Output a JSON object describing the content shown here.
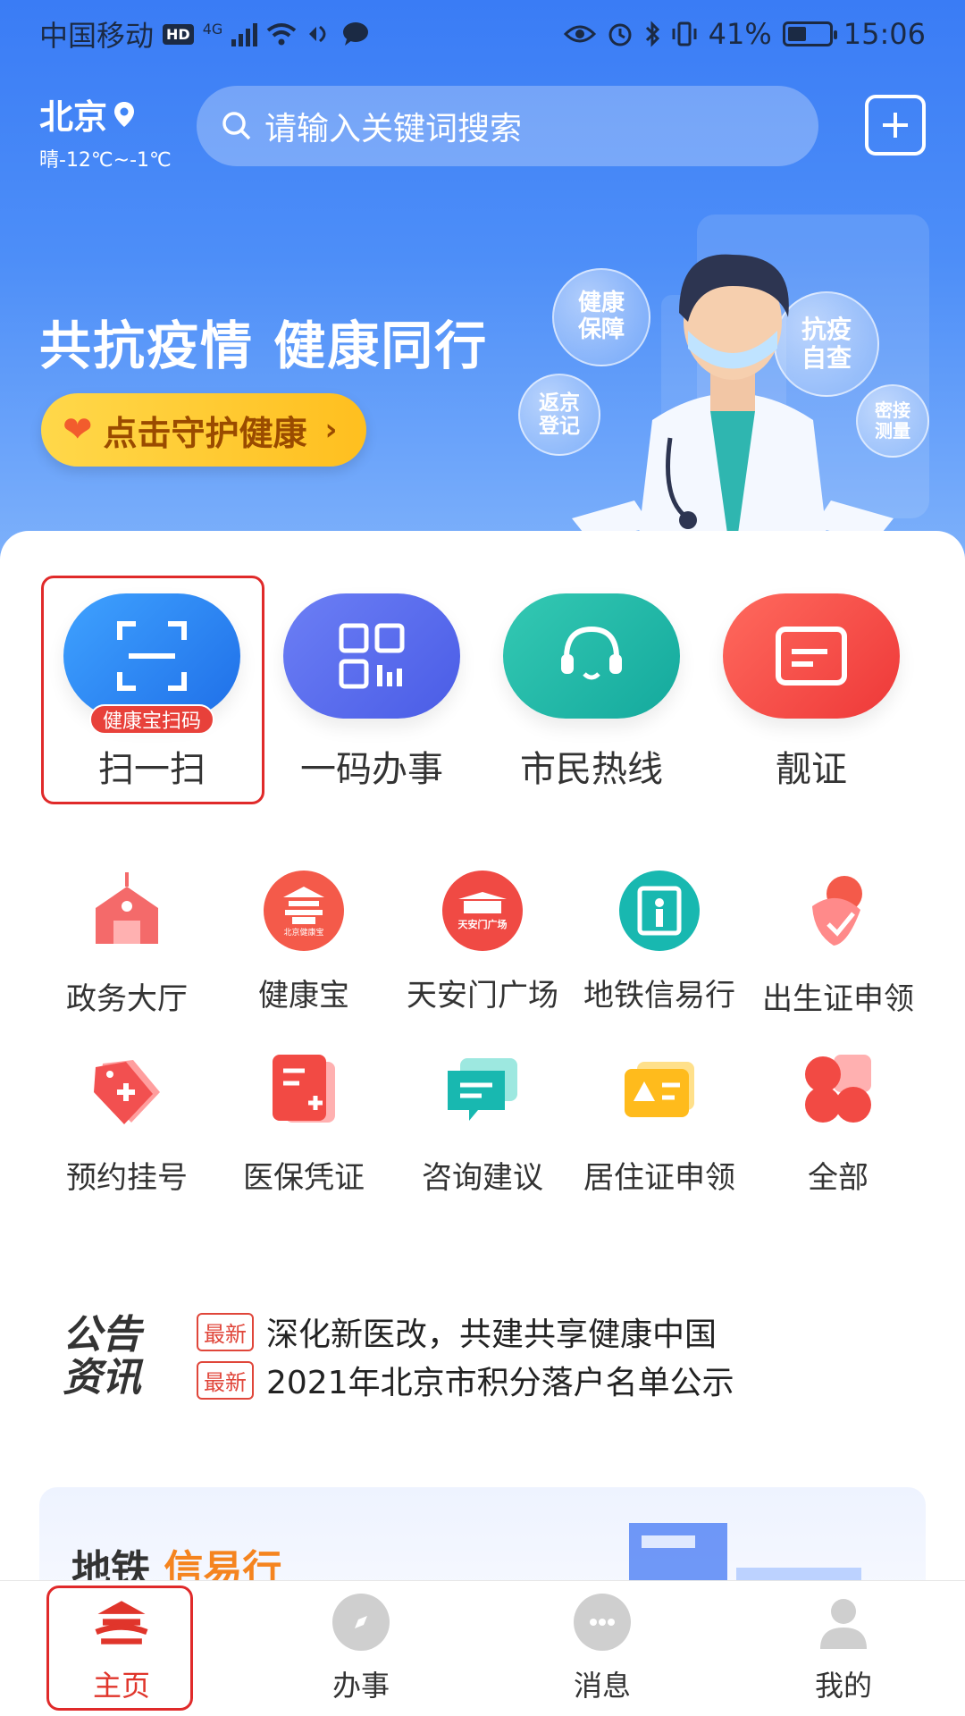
{
  "status_bar": {
    "carrier": "中国移动",
    "hd": "HD",
    "network": "4G",
    "battery": "41%",
    "time": "15:06"
  },
  "header": {
    "city": "北京",
    "weather": "晴-12℃~-1℃",
    "search_placeholder": "请输入关键词搜索"
  },
  "banner": {
    "slogan": "共抗疫情  健康同行",
    "cta_label": "点击守护健康",
    "bubbles": [
      "健康保障",
      "抗疫自查",
      "返京登记",
      "密接测量"
    ]
  },
  "main_functions": [
    {
      "label": "扫一扫",
      "badge": "健康宝扫码",
      "color": "#2f8cf5"
    },
    {
      "label": "一码办事",
      "color": "#5b6cf0"
    },
    {
      "label": "市民热线",
      "color": "#22b8a8"
    },
    {
      "label": "靓证",
      "color": "#f24b4b"
    }
  ],
  "services": [
    {
      "label": "政务大厅",
      "icon": "government-hall-icon"
    },
    {
      "label": "健康宝",
      "icon": "health-treasure-icon",
      "icon_text": "北京健康宝"
    },
    {
      "label": "天安门广场",
      "icon": "tiananmen-icon",
      "icon_text": "天安门广场"
    },
    {
      "label": "地铁信易行",
      "icon": "metro-gate-icon"
    },
    {
      "label": "出生证申领",
      "icon": "birth-certificate-icon"
    },
    {
      "label": "预约挂号",
      "icon": "appointment-tag-icon"
    },
    {
      "label": "医保凭证",
      "icon": "medical-insurance-icon"
    },
    {
      "label": "咨询建议",
      "icon": "consult-chat-icon"
    },
    {
      "label": "居住证申领",
      "icon": "residence-card-icon"
    },
    {
      "label": "全部",
      "icon": "all-services-icon"
    }
  ],
  "notice": {
    "logo_line1": "公告",
    "logo_line2": "资讯",
    "tag": "最新",
    "items": [
      "深化新医改，共建共享健康中国",
      "2021年北京市积分落户名单公示"
    ]
  },
  "metro_card": {
    "title_part1": "地铁",
    "title_part2": "信易行"
  },
  "tabbar": [
    {
      "label": "主页",
      "active": true
    },
    {
      "label": "办事",
      "active": false
    },
    {
      "label": "消息",
      "active": false
    },
    {
      "label": "我的",
      "active": false
    }
  ],
  "colors": {
    "primary_blue": "#3a7cf5",
    "accent_red": "#e0352b",
    "cta_yellow": "#ffc928"
  }
}
